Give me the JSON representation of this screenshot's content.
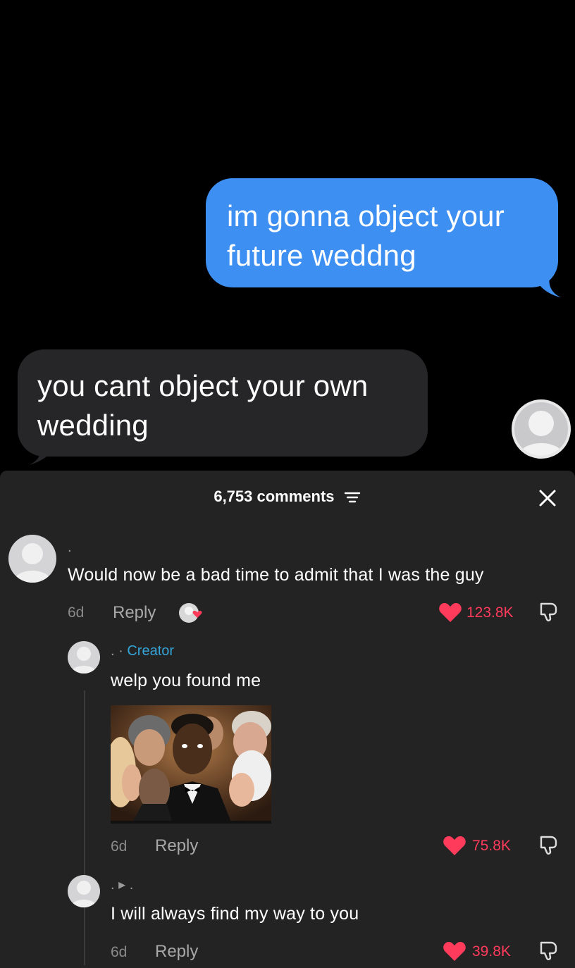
{
  "chat": {
    "outgoing_message": "im gonna object your future weddng",
    "incoming_message": "you cant object your own wedding"
  },
  "comments_panel": {
    "count_label": "6,753 comments",
    "comments": [
      {
        "username": ".",
        "text": "Would now be a bad time to admit that I was the guy",
        "time": "6d",
        "reply_label": "Reply",
        "likes": "123.8K"
      },
      {
        "username": ". ·",
        "creator_label": "Creator",
        "text": "welp you found me",
        "time": "6d",
        "reply_label": "Reply",
        "likes": "75.8K"
      },
      {
        "username": ". ▸ .",
        "text": "I will always find my way to you",
        "time": "6d",
        "reply_label": "Reply",
        "likes": "39.8K"
      }
    ]
  },
  "colors": {
    "outgoing_bubble": "#3d8ff2",
    "incoming_bubble": "#262628",
    "like_red": "#ff3b5c",
    "creator_blue": "#35a4d8",
    "sheet_bg": "#232323"
  },
  "icons": [
    "filter-icon",
    "close-icon",
    "heart-icon",
    "dislike-icon",
    "avatar-placeholder"
  ]
}
